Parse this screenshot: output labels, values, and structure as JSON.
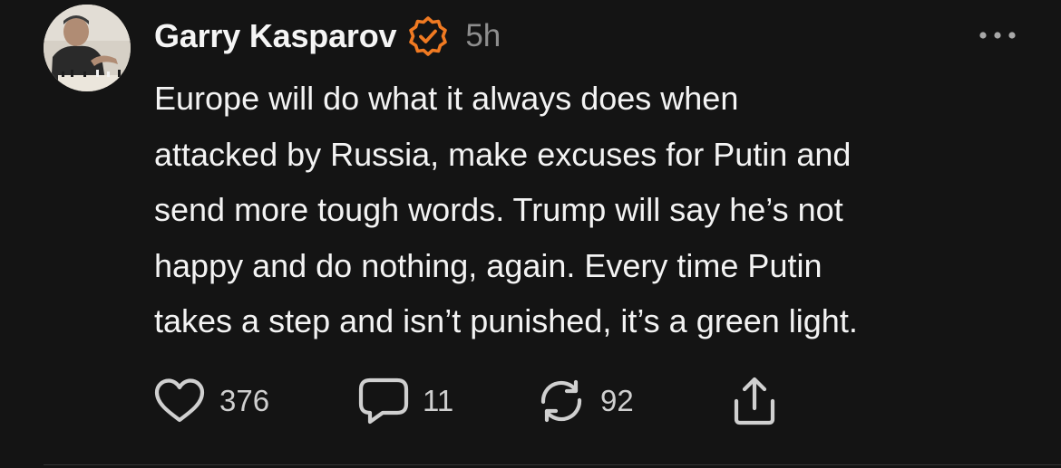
{
  "post": {
    "author": "Garry Kasparov",
    "verified": true,
    "time": "5h",
    "text": "Europe will do what it always does when attacked by Russia, make excuses for Putin and send more tough words. Trump will say he’s not happy and do nothing, again. Every time Putin takes a step and isn’t punished, it’s a green light.",
    "lines": [
      "Europe will do what it always does when",
      "attacked by Russia, make excuses for Putin and",
      "send more tough words. Trump will say he’s not",
      "happy and do nothing, again. Every time Putin",
      "takes a step and isn’t punished, it’s a green light."
    ]
  },
  "actions": {
    "likes": "376",
    "replies": "11",
    "reposts": "92"
  },
  "icons": {
    "avatar": "avatar-photo",
    "verified": "verified-badge-icon",
    "more": "more-dots-icon",
    "like": "heart-icon",
    "reply": "comment-bubble-icon",
    "repost": "repost-arrows-icon",
    "share": "share-upload-icon"
  },
  "colors": {
    "background": "#141414",
    "text": "#f3f3f3",
    "muted": "#8e8e8e",
    "verified": "#f07a22"
  }
}
